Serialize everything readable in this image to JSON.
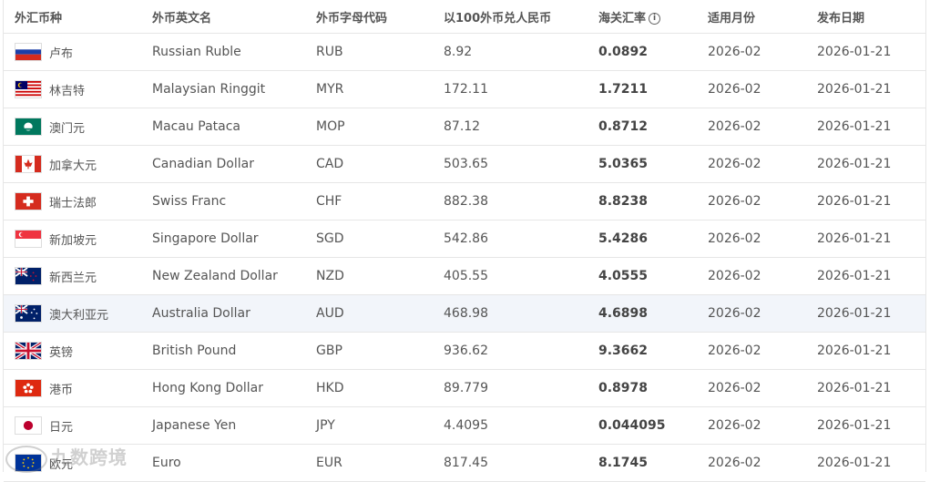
{
  "headers": {
    "currency": "外汇币种",
    "english_name": "外币英文名",
    "code": "外币字母代码",
    "per100": "以100外币兑人民币",
    "customs_rate": "海关汇率",
    "month": "适用月份",
    "publish_date": "发布日期"
  },
  "rows": [
    {
      "name": "卢布",
      "en": "Russian Ruble",
      "code": "RUB",
      "per100": "8.92",
      "rate": "0.0892",
      "month": "2026-02",
      "date": "2026-01-21"
    },
    {
      "name": "林吉特",
      "en": "Malaysian Ringgit",
      "code": "MYR",
      "per100": "172.11",
      "rate": "1.7211",
      "month": "2026-02",
      "date": "2026-01-21"
    },
    {
      "name": "澳门元",
      "en": "Macau Pataca",
      "code": "MOP",
      "per100": "87.12",
      "rate": "0.8712",
      "month": "2026-02",
      "date": "2026-01-21"
    },
    {
      "name": "加拿大元",
      "en": "Canadian Dollar",
      "code": "CAD",
      "per100": "503.65",
      "rate": "5.0365",
      "month": "2026-02",
      "date": "2026-01-21"
    },
    {
      "name": "瑞士法郎",
      "en": "Swiss Franc",
      "code": "CHF",
      "per100": "882.38",
      "rate": "8.8238",
      "month": "2026-02",
      "date": "2026-01-21"
    },
    {
      "name": "新加坡元",
      "en": "Singapore Dollar",
      "code": "SGD",
      "per100": "542.86",
      "rate": "5.4286",
      "month": "2026-02",
      "date": "2026-01-21"
    },
    {
      "name": "新西兰元",
      "en": "New Zealand Dollar",
      "code": "NZD",
      "per100": "405.55",
      "rate": "4.0555",
      "month": "2026-02",
      "date": "2026-01-21"
    },
    {
      "name": "澳大利亚元",
      "en": "Australia Dollar",
      "code": "AUD",
      "per100": "468.98",
      "rate": "4.6898",
      "month": "2026-02",
      "date": "2026-01-21"
    },
    {
      "name": "英镑",
      "en": "British Pound",
      "code": "GBP",
      "per100": "936.62",
      "rate": "9.3662",
      "month": "2026-02",
      "date": "2026-01-21"
    },
    {
      "name": "港币",
      "en": "Hong Kong Dollar",
      "code": "HKD",
      "per100": "89.779",
      "rate": "0.8978",
      "month": "2026-02",
      "date": "2026-01-21"
    },
    {
      "name": "日元",
      "en": "Japanese Yen",
      "code": "JPY",
      "per100": "4.4095",
      "rate": "0.044095",
      "month": "2026-02",
      "date": "2026-01-21"
    },
    {
      "name": "欧元",
      "en": "Euro",
      "code": "EUR",
      "per100": "817.45",
      "rate": "8.1745",
      "month": "2026-02",
      "date": "2026-01-21"
    }
  ],
  "highlighted_row": 7,
  "watermark": "九数跨境"
}
